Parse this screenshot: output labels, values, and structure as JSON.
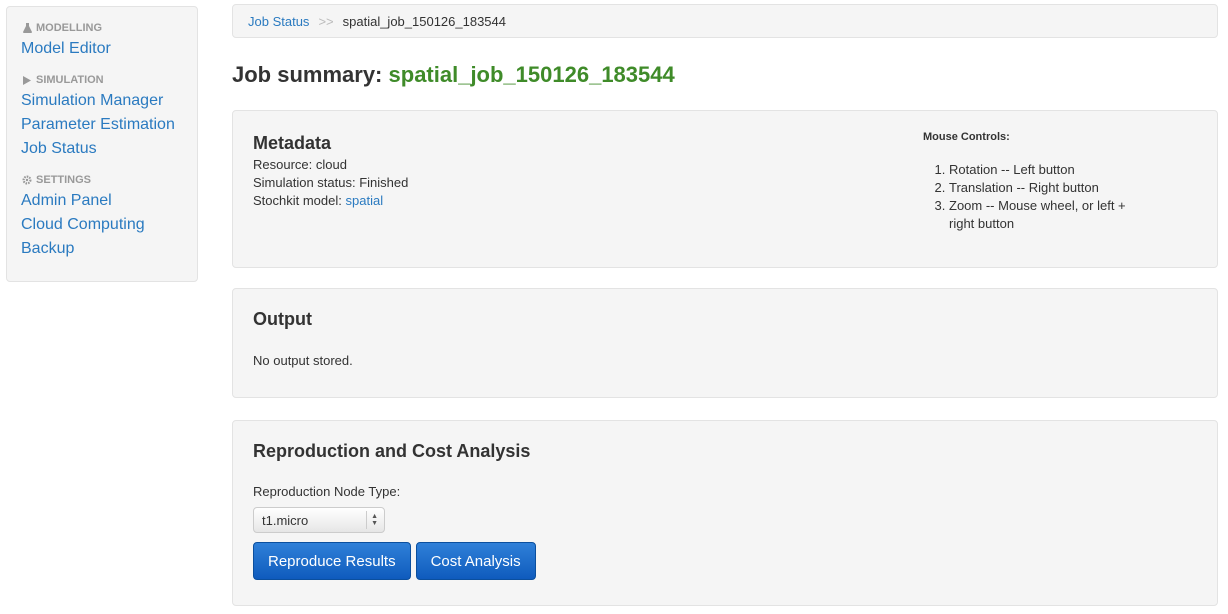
{
  "sidebar": {
    "modelling": {
      "header": "MODELLING",
      "icon": "flask-icon",
      "items": [
        {
          "label": "Model Editor"
        }
      ]
    },
    "simulation": {
      "header": "SIMULATION",
      "icon": "play-icon",
      "items": [
        {
          "label": "Simulation Manager"
        },
        {
          "label": "Parameter Estimation"
        },
        {
          "label": "Job Status"
        }
      ]
    },
    "settings": {
      "header": "SETTINGS",
      "icon": "gear-icon",
      "items": [
        {
          "label": "Admin Panel"
        },
        {
          "label": "Cloud Computing"
        },
        {
          "label": "Backup"
        }
      ]
    }
  },
  "breadcrumb": {
    "link": "Job Status",
    "separator": ">>",
    "current": "spatial_job_150126_183544"
  },
  "page": {
    "title_prefix": "Job summary:",
    "job_name": "spatial_job_150126_183544"
  },
  "metadata": {
    "heading": "Metadata",
    "resource": "Resource: cloud",
    "status": "Simulation status: Finished",
    "model_label": "Stochkit model:",
    "model_link": "spatial",
    "mouse_controls_title": "Mouse Controls:",
    "mouse_controls": [
      "Rotation -- Left button",
      "Translation -- Right button",
      "Zoom -- Mouse wheel, or left + right button"
    ]
  },
  "output": {
    "heading": "Output",
    "message": "No output stored."
  },
  "reproduction": {
    "heading": "Reproduction and Cost Analysis",
    "node_type_label": "Reproduction Node Type:",
    "node_type_value": "t1.micro",
    "reproduce_button": "Reproduce Results",
    "cost_button": "Cost Analysis"
  },
  "colors": {
    "link": "#2a7ac0",
    "job_name": "#3f8b29",
    "button_primary": "#1a6acb"
  }
}
